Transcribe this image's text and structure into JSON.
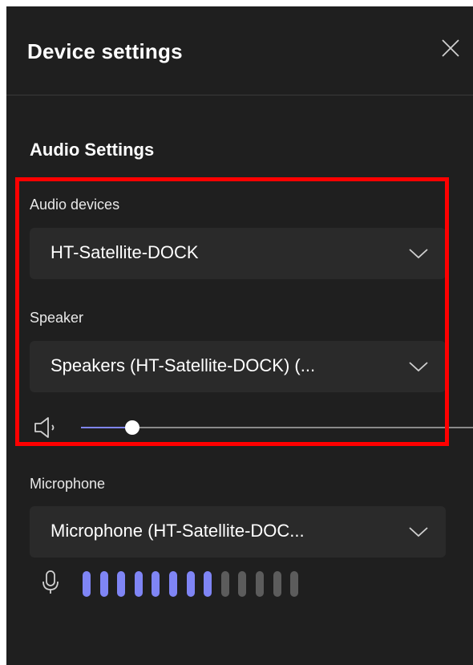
{
  "panel": {
    "title": "Device settings",
    "close_icon": "close-icon"
  },
  "audio_settings": {
    "section_title": "Audio Settings",
    "audio_devices": {
      "label": "Audio devices",
      "selected": "HT-Satellite-DOCK",
      "icon": "chevron-down-icon"
    },
    "speaker": {
      "label": "Speaker",
      "selected": "Speakers (HT-Satellite-DOCK) (...",
      "icon": "chevron-down-icon",
      "volume_icon": "speaker-icon",
      "volume_level": 0.13
    },
    "microphone": {
      "label": "Microphone",
      "selected": "Microphone (HT-Satellite-DOC...",
      "icon": "chevron-down-icon",
      "mic_icon": "microphone-icon",
      "meter_total": 13,
      "meter_active": 8
    }
  },
  "colors": {
    "panel_bg": "#1f1f1f",
    "dropdown_bg": "#2a2a2a",
    "accent": "#7f85f5",
    "highlight_border": "#ff0000"
  }
}
